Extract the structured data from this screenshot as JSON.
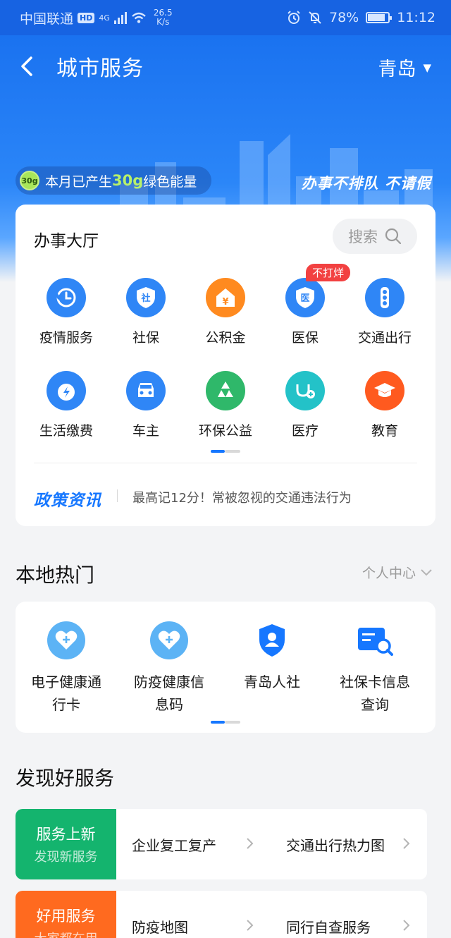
{
  "status_bar": {
    "carrier": "中国联通",
    "hd": "HD",
    "network": "4G",
    "speed_value": "26.5",
    "speed_unit": "K/s",
    "battery": "78%",
    "time": "11:12"
  },
  "nav": {
    "title": "城市服务",
    "city": "青岛"
  },
  "hero": {
    "energy_badge": "30g",
    "energy_prefix": "本月已产生",
    "energy_amount": "30g",
    "energy_suffix": "绿色能量",
    "slogan": "办事不排队 不请假"
  },
  "hall": {
    "title": "办事大厅",
    "search_label": "搜索",
    "badge": "不打烊",
    "services": [
      {
        "label": "疫情服务",
        "icon": "clock-refresh-icon",
        "color": "#2f86f6"
      },
      {
        "label": "社保",
        "icon": "shield-she-icon",
        "color": "#2f86f6"
      },
      {
        "label": "公积金",
        "icon": "house-yen-icon",
        "color": "#ff8a1f"
      },
      {
        "label": "医保",
        "icon": "shield-yi-icon",
        "color": "#2f86f6"
      },
      {
        "label": "交通出行",
        "icon": "traffic-light-icon",
        "color": "#2f86f6"
      },
      {
        "label": "生活缴费",
        "icon": "water-drop-icon",
        "color": "#2f86f6"
      },
      {
        "label": "车主",
        "icon": "car-icon",
        "color": "#2f86f6"
      },
      {
        "label": "环保公益",
        "icon": "recycle-icon",
        "color": "#2fb86a"
      },
      {
        "label": "医疗",
        "icon": "stethoscope-icon",
        "color": "#23c2c8"
      },
      {
        "label": "教育",
        "icon": "graduation-cap-icon",
        "color": "#ff5a1f"
      }
    ],
    "policy_logo": "政策资讯",
    "policy_text": "最高记12分！常被忽视的交通违法行为"
  },
  "hot": {
    "title": "本地热门",
    "more": "个人中心",
    "items": [
      {
        "line1": "电子健康通",
        "line2": "行卡",
        "icon": "heart-plus-icon"
      },
      {
        "line1": "防疫健康信",
        "line2": "息码",
        "icon": "heart-plus-icon"
      },
      {
        "line1": "青岛人社",
        "line2": "",
        "icon": "shield-person-icon"
      },
      {
        "line1": "社保卡信息",
        "line2": "查询",
        "icon": "card-search-icon"
      }
    ]
  },
  "discover": {
    "title": "发现好服务",
    "rows": [
      {
        "tag_title": "服务上新",
        "tag_sub": "发现新服务",
        "tag_color": "#14b46e",
        "item1": "企业复工复产",
        "item2": "交通出行热力图"
      },
      {
        "tag_title": "好用服务",
        "tag_sub": "大家都在用",
        "tag_color": "#ff6a1f",
        "item1": "防疫地图",
        "item2": "同行自查服务"
      }
    ]
  },
  "colors": {
    "primary": "#1677ff",
    "status_bar": "#1763e2",
    "alert_red": "#f24141"
  }
}
